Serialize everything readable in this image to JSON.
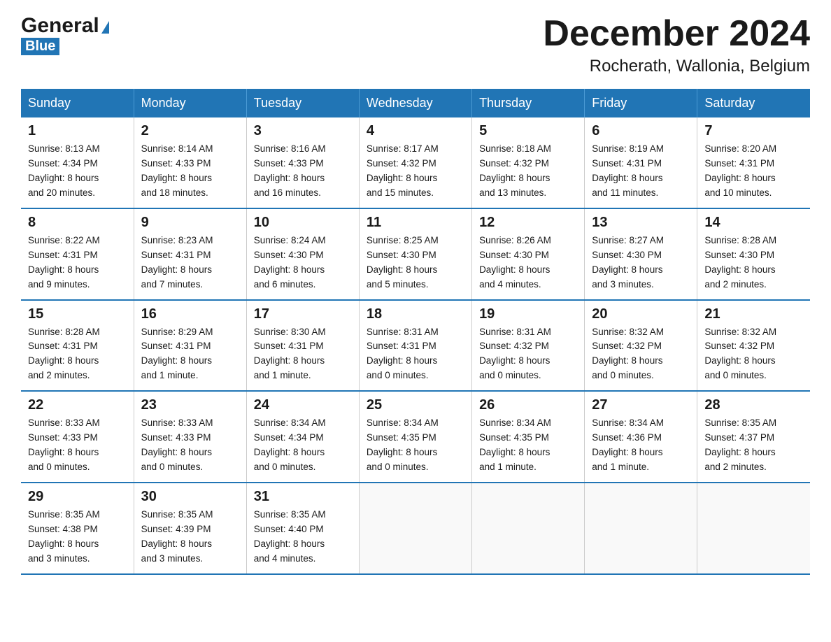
{
  "logo": {
    "general": "General",
    "blue": "Blue"
  },
  "title": "December 2024",
  "subtitle": "Rocherath, Wallonia, Belgium",
  "days_of_week": [
    "Sunday",
    "Monday",
    "Tuesday",
    "Wednesday",
    "Thursday",
    "Friday",
    "Saturday"
  ],
  "weeks": [
    [
      {
        "day": "1",
        "sunrise": "8:13 AM",
        "sunset": "4:34 PM",
        "daylight": "8 hours and 20 minutes."
      },
      {
        "day": "2",
        "sunrise": "8:14 AM",
        "sunset": "4:33 PM",
        "daylight": "8 hours and 18 minutes."
      },
      {
        "day": "3",
        "sunrise": "8:16 AM",
        "sunset": "4:33 PM",
        "daylight": "8 hours and 16 minutes."
      },
      {
        "day": "4",
        "sunrise": "8:17 AM",
        "sunset": "4:32 PM",
        "daylight": "8 hours and 15 minutes."
      },
      {
        "day": "5",
        "sunrise": "8:18 AM",
        "sunset": "4:32 PM",
        "daylight": "8 hours and 13 minutes."
      },
      {
        "day": "6",
        "sunrise": "8:19 AM",
        "sunset": "4:31 PM",
        "daylight": "8 hours and 11 minutes."
      },
      {
        "day": "7",
        "sunrise": "8:20 AM",
        "sunset": "4:31 PM",
        "daylight": "8 hours and 10 minutes."
      }
    ],
    [
      {
        "day": "8",
        "sunrise": "8:22 AM",
        "sunset": "4:31 PM",
        "daylight": "8 hours and 9 minutes."
      },
      {
        "day": "9",
        "sunrise": "8:23 AM",
        "sunset": "4:31 PM",
        "daylight": "8 hours and 7 minutes."
      },
      {
        "day": "10",
        "sunrise": "8:24 AM",
        "sunset": "4:30 PM",
        "daylight": "8 hours and 6 minutes."
      },
      {
        "day": "11",
        "sunrise": "8:25 AM",
        "sunset": "4:30 PM",
        "daylight": "8 hours and 5 minutes."
      },
      {
        "day": "12",
        "sunrise": "8:26 AM",
        "sunset": "4:30 PM",
        "daylight": "8 hours and 4 minutes."
      },
      {
        "day": "13",
        "sunrise": "8:27 AM",
        "sunset": "4:30 PM",
        "daylight": "8 hours and 3 minutes."
      },
      {
        "day": "14",
        "sunrise": "8:28 AM",
        "sunset": "4:30 PM",
        "daylight": "8 hours and 2 minutes."
      }
    ],
    [
      {
        "day": "15",
        "sunrise": "8:28 AM",
        "sunset": "4:31 PM",
        "daylight": "8 hours and 2 minutes."
      },
      {
        "day": "16",
        "sunrise": "8:29 AM",
        "sunset": "4:31 PM",
        "daylight": "8 hours and 1 minute."
      },
      {
        "day": "17",
        "sunrise": "8:30 AM",
        "sunset": "4:31 PM",
        "daylight": "8 hours and 1 minute."
      },
      {
        "day": "18",
        "sunrise": "8:31 AM",
        "sunset": "4:31 PM",
        "daylight": "8 hours and 0 minutes."
      },
      {
        "day": "19",
        "sunrise": "8:31 AM",
        "sunset": "4:32 PM",
        "daylight": "8 hours and 0 minutes."
      },
      {
        "day": "20",
        "sunrise": "8:32 AM",
        "sunset": "4:32 PM",
        "daylight": "8 hours and 0 minutes."
      },
      {
        "day": "21",
        "sunrise": "8:32 AM",
        "sunset": "4:32 PM",
        "daylight": "8 hours and 0 minutes."
      }
    ],
    [
      {
        "day": "22",
        "sunrise": "8:33 AM",
        "sunset": "4:33 PM",
        "daylight": "8 hours and 0 minutes."
      },
      {
        "day": "23",
        "sunrise": "8:33 AM",
        "sunset": "4:33 PM",
        "daylight": "8 hours and 0 minutes."
      },
      {
        "day": "24",
        "sunrise": "8:34 AM",
        "sunset": "4:34 PM",
        "daylight": "8 hours and 0 minutes."
      },
      {
        "day": "25",
        "sunrise": "8:34 AM",
        "sunset": "4:35 PM",
        "daylight": "8 hours and 0 minutes."
      },
      {
        "day": "26",
        "sunrise": "8:34 AM",
        "sunset": "4:35 PM",
        "daylight": "8 hours and 1 minute."
      },
      {
        "day": "27",
        "sunrise": "8:34 AM",
        "sunset": "4:36 PM",
        "daylight": "8 hours and 1 minute."
      },
      {
        "day": "28",
        "sunrise": "8:35 AM",
        "sunset": "4:37 PM",
        "daylight": "8 hours and 2 minutes."
      }
    ],
    [
      {
        "day": "29",
        "sunrise": "8:35 AM",
        "sunset": "4:38 PM",
        "daylight": "8 hours and 3 minutes."
      },
      {
        "day": "30",
        "sunrise": "8:35 AM",
        "sunset": "4:39 PM",
        "daylight": "8 hours and 3 minutes."
      },
      {
        "day": "31",
        "sunrise": "8:35 AM",
        "sunset": "4:40 PM",
        "daylight": "8 hours and 4 minutes."
      },
      null,
      null,
      null,
      null
    ]
  ],
  "labels": {
    "sunrise": "Sunrise:",
    "sunset": "Sunset:",
    "daylight": "Daylight:"
  }
}
